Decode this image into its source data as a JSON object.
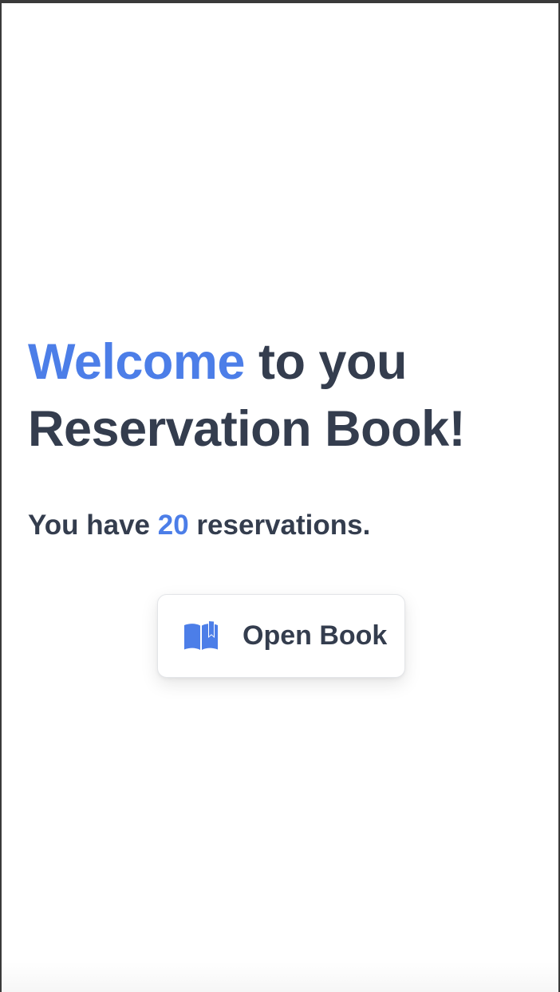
{
  "welcome": {
    "accent_word": "Welcome",
    "line1_rest": "to you",
    "line2": "Reservation Book!"
  },
  "summary": {
    "prefix": "You have",
    "count": "20",
    "suffix": "reservations."
  },
  "open_button": {
    "label": "Open Book",
    "icon": "book-open-icon"
  },
  "colors": {
    "accent": "#4c7ee8",
    "text": "#343d4e",
    "background": "#ffffff"
  }
}
